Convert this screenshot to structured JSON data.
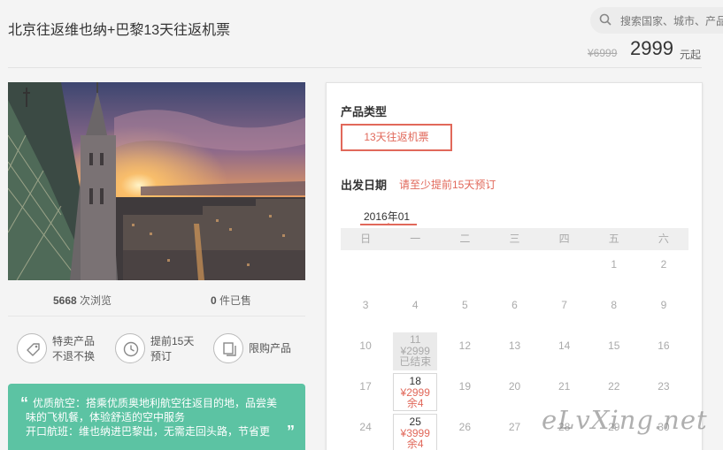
{
  "header": {
    "title": "北京往返维也纳+巴黎13天往返机票",
    "search_placeholder": "搜索国家、城市、产品"
  },
  "price": {
    "original": "¥6999",
    "current": "2999",
    "suffix": "元起"
  },
  "stats": {
    "views_count": "5668",
    "views_label": "次浏览",
    "sold_count": "0",
    "sold_label": "件已售"
  },
  "features": [
    {
      "icon": "tag-icon",
      "line1": "特卖产品",
      "line2": "不退不换"
    },
    {
      "icon": "clock-icon",
      "line1": "提前15天",
      "line2": "预订"
    },
    {
      "icon": "copy-icon",
      "line1": "限购产品",
      "line2": ""
    }
  ],
  "highlights": {
    "line1": "优质航空：搭乘优质奥地利航空往返目的地，品尝美",
    "line2": "味的飞机餐，体验舒适的空中服务",
    "line3": "开口航班：维也纳进巴黎出，无需走回头路，节省更"
  },
  "booking": {
    "product_type_label": "产品类型",
    "product_type_option": "13天往返机票",
    "date_label": "出发日期",
    "date_note": "请至少提前15天预订",
    "month": "2016年01",
    "weekdays": [
      "日",
      "一",
      "二",
      "三",
      "四",
      "五",
      "六"
    ],
    "rows": [
      [
        {
          "d": ""
        },
        {
          "d": ""
        },
        {
          "d": ""
        },
        {
          "d": ""
        },
        {
          "d": ""
        },
        {
          "d": "1"
        },
        {
          "d": "2"
        }
      ],
      [
        {
          "d": "3"
        },
        {
          "d": "4"
        },
        {
          "d": "5"
        },
        {
          "d": "6"
        },
        {
          "d": "7"
        },
        {
          "d": "8"
        },
        {
          "d": "9"
        }
      ],
      [
        {
          "d": "10"
        },
        {
          "d": "11",
          "price": "¥2999",
          "status": "已结束",
          "state": "past"
        },
        {
          "d": "12"
        },
        {
          "d": "13"
        },
        {
          "d": "14"
        },
        {
          "d": "15"
        },
        {
          "d": "16"
        }
      ],
      [
        {
          "d": "17"
        },
        {
          "d": "18",
          "price": "¥2999",
          "status": "余4",
          "state": "avail"
        },
        {
          "d": "19"
        },
        {
          "d": "20"
        },
        {
          "d": "21"
        },
        {
          "d": "22"
        },
        {
          "d": "23"
        }
      ],
      [
        {
          "d": "24"
        },
        {
          "d": "25",
          "price": "¥3999",
          "status": "余4",
          "state": "avail"
        },
        {
          "d": "26"
        },
        {
          "d": "27"
        },
        {
          "d": "28"
        },
        {
          "d": "29"
        },
        {
          "d": "30"
        }
      ]
    ]
  },
  "watermark": "eLvXing.net",
  "colors": {
    "accent": "#e1685a",
    "highlight_bg": "#5cc3a3"
  }
}
